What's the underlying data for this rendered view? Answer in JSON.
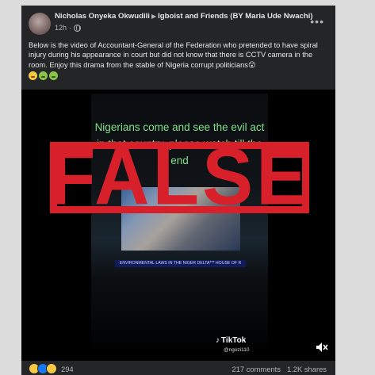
{
  "post": {
    "author": "Nicholas Onyeka Okwudili",
    "group": "Igboist and Friends (BY Maria Ude Nwachi)",
    "time": "12h",
    "text": "Below is the video of Accountant-General of the Federation who pretended to have spiral injury during his appearance in court but did not know that there is CCTV camera in the room. Enjoy this drama from the stable of Nigeria corrupt politicians😮"
  },
  "video": {
    "overlay_text": "Nigerians come and see the evil act in that country, please watch till the end",
    "caption_bar": "ENVIRONMENTAL LAWS IN THE NIGER DELTA*** HOUSE OF R",
    "stamp": "FALSE",
    "tiktok_brand": "TikTok",
    "tiktok_user": "@ngozi110"
  },
  "footer": {
    "reaction_count": "294",
    "comments": "217 comments",
    "shares": "1.2K shares"
  },
  "icons": {
    "more": "more-icon",
    "privacy": "globe-icon",
    "mute": "mute-icon",
    "tiktok": "tiktok-icon"
  },
  "colors": {
    "card_bg": "#242526",
    "stamp_red": "#d8202a",
    "overlay_green": "#7fe08a"
  }
}
